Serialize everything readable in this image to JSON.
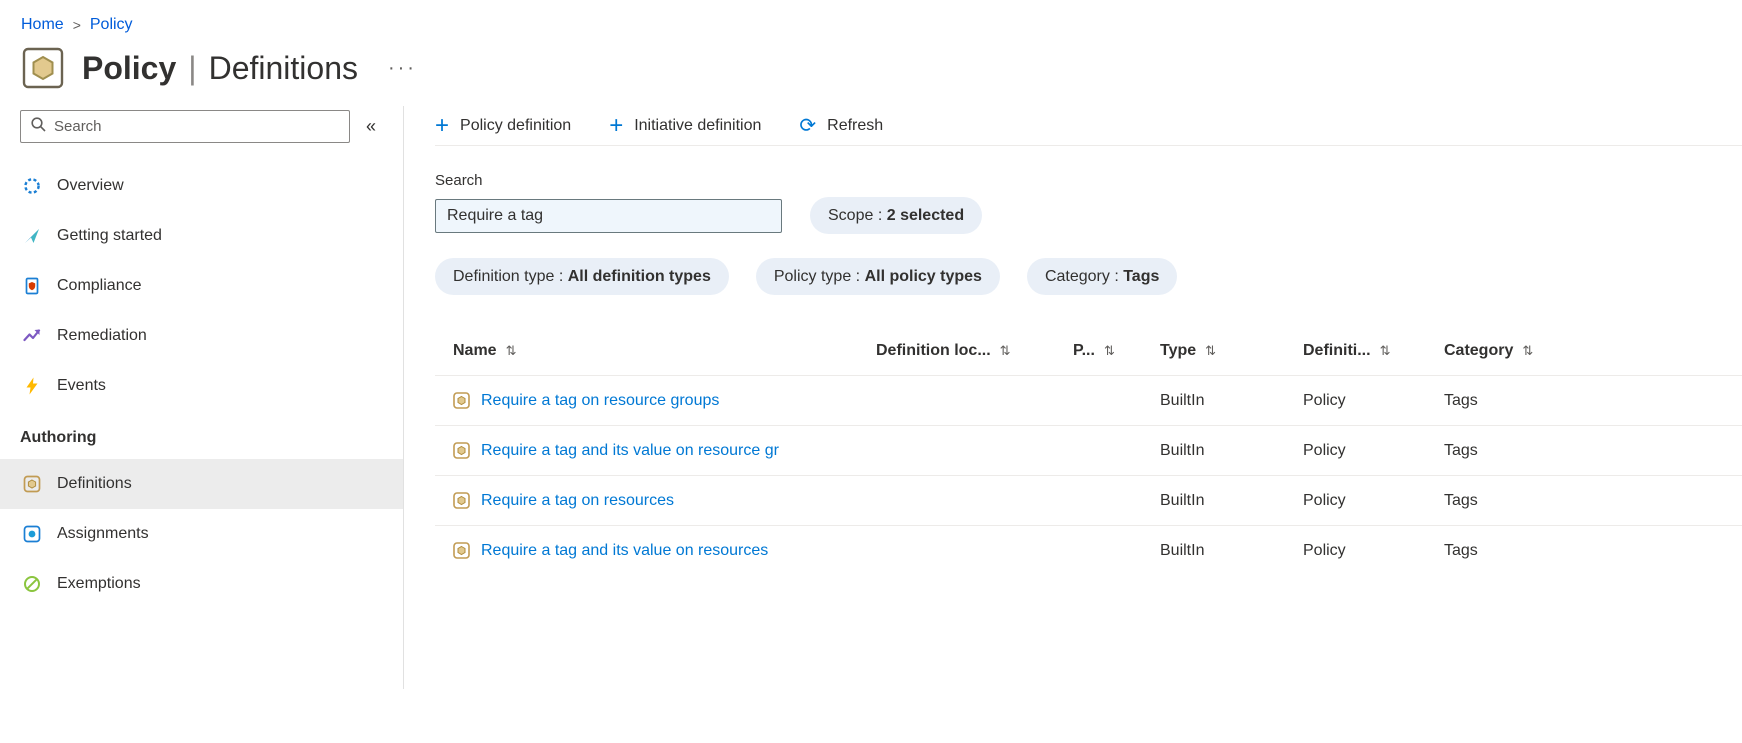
{
  "icons": {
    "breadcrumb_separator": ">",
    "more": "···",
    "collapse": "«",
    "plus": "+",
    "refresh": "⟳",
    "sort": "⇅"
  },
  "breadcrumb": {
    "items": [
      {
        "label": "Home"
      },
      {
        "label": "Policy"
      }
    ]
  },
  "header": {
    "title": "Policy",
    "separator": "|",
    "subtitle": "Definitions"
  },
  "sidebar": {
    "search_placeholder": "Search",
    "items": [
      {
        "label": "Overview",
        "icon": "overview-icon"
      },
      {
        "label": "Getting started",
        "icon": "getting-started-icon"
      },
      {
        "label": "Compliance",
        "icon": "compliance-icon"
      },
      {
        "label": "Remediation",
        "icon": "remediation-icon"
      },
      {
        "label": "Events",
        "icon": "events-icon"
      }
    ],
    "section_title": "Authoring",
    "authoring_items": [
      {
        "label": "Definitions",
        "icon": "definitions-icon",
        "selected": true
      },
      {
        "label": "Assignments",
        "icon": "assignments-icon",
        "selected": false
      },
      {
        "label": "Exemptions",
        "icon": "exemptions-icon",
        "selected": false
      }
    ]
  },
  "toolbar": {
    "buttons": [
      {
        "label": "Policy definition",
        "icon": "plus-icon"
      },
      {
        "label": "Initiative definition",
        "icon": "plus-icon"
      },
      {
        "label": "Refresh",
        "icon": "refresh-icon"
      }
    ]
  },
  "filters": {
    "search_label": "Search",
    "search_value": "Require a tag",
    "separator": " : ",
    "pills": [
      {
        "label": "Scope",
        "value": "2 selected"
      },
      {
        "label": "Definition type",
        "value": "All definition types"
      },
      {
        "label": "Policy type",
        "value": "All policy types"
      },
      {
        "label": "Category",
        "value": "Tags"
      }
    ]
  },
  "table": {
    "columns": [
      "Name",
      "Definition loc...",
      "P...",
      "Type",
      "Definiti...",
      "Category"
    ],
    "rows": [
      {
        "name": "Require a tag on resource groups",
        "type": "BuiltIn",
        "definition_type": "Policy",
        "category": "Tags"
      },
      {
        "name": "Require a tag and its value on resource gr",
        "type": "BuiltIn",
        "definition_type": "Policy",
        "category": "Tags"
      },
      {
        "name": "Require a tag on resources",
        "type": "BuiltIn",
        "definition_type": "Policy",
        "category": "Tags"
      },
      {
        "name": "Require a tag and its value on resources",
        "type": "BuiltIn",
        "definition_type": "Policy",
        "category": "Tags"
      }
    ]
  },
  "colors": {
    "link": "#0078d4",
    "breadcrumb_link": "#015cda",
    "text": "#323130",
    "pill_background": "#e9eff7",
    "selected_item_background": "#ececec",
    "events_yellow": "#ffb900",
    "policy_icon_tan": "#e2c98e"
  }
}
